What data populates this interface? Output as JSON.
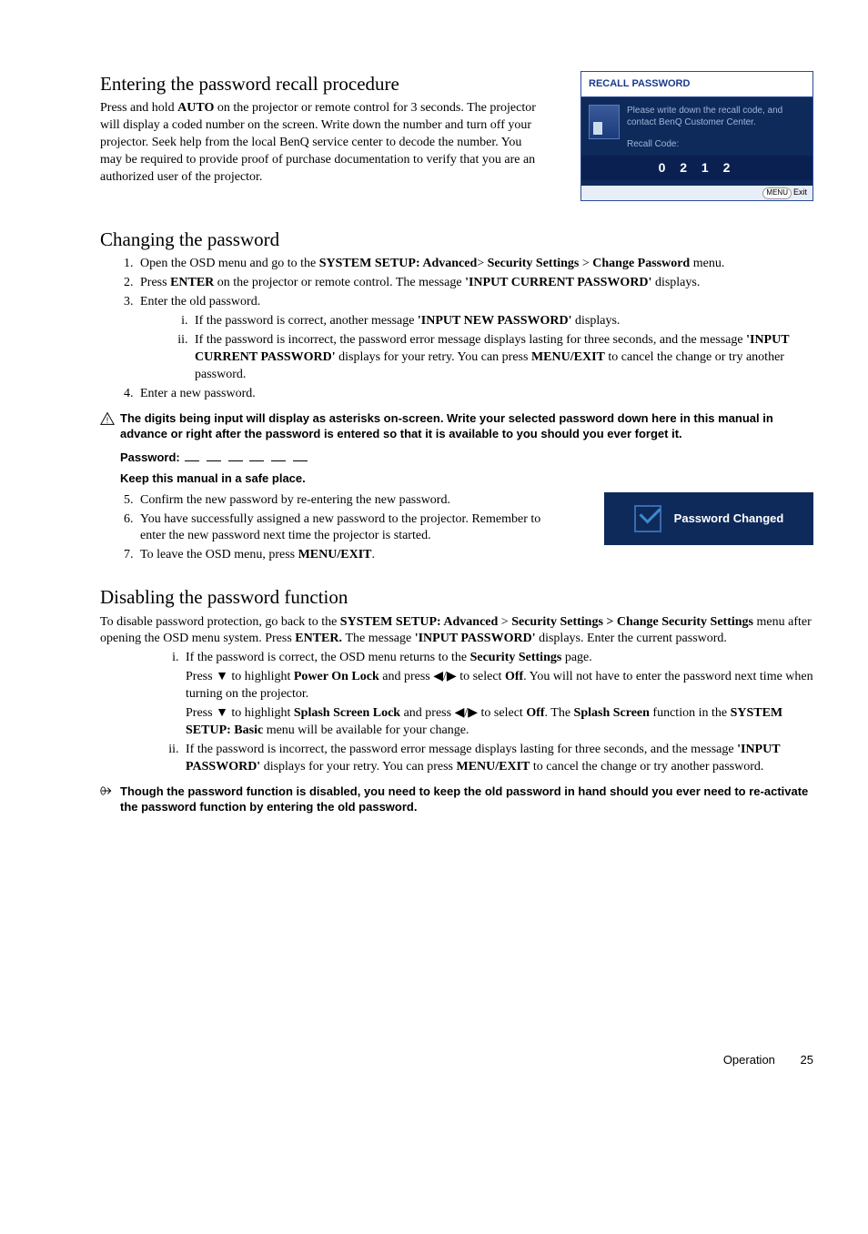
{
  "section1": {
    "heading": "Entering the password recall procedure",
    "para": "Press and hold AUTO on the projector or remote control for 3 seconds. The projector will display a coded number on the screen. Write down the number and turn off your projector. Seek help from the local BenQ service center to decode the number. You may be required to provide proof of purchase documentation to verify that you are an authorized user of the projector."
  },
  "recallBox": {
    "title": "RECALL PASSWORD",
    "msg": "Please write down the recall code, and contact BenQ Customer Center.",
    "codeLabel": "Recall Code:",
    "code": "0 2 1 2",
    "menuBtn": "MENU",
    "exit": "Exit"
  },
  "section2": {
    "heading": "Changing the password",
    "li1_a": "Open the OSD menu and go to the ",
    "li1_b": "SYSTEM SETUP: Advanced",
    "li1_c": "> ",
    "li1_d": "Security Settings",
    "li1_e": " > ",
    "li1_f": "Change Password",
    "li1_g": " menu.",
    "li2_a": "Press ",
    "li2_b": "ENTER",
    "li2_c": " on the projector or remote control. The message ",
    "li2_d": "'INPUT CURRENT PASSWORD'",
    "li2_e": " displays.",
    "li3": "Enter the old password.",
    "li3i_a": "If the password is correct, another message ",
    "li3i_b": "'INPUT NEW PASSWORD'",
    "li3i_c": " displays.",
    "li3ii_a": "If the password is incorrect, the password error message displays lasting for three seconds, and the message ",
    "li3ii_b": "'INPUT CURRENT PASSWORD'",
    "li3ii_c": " displays for your retry. You can press ",
    "li3ii_d": "MENU/EXIT",
    "li3ii_e": " to cancel the change or try another password.",
    "li4": "Enter a new password.",
    "warn": "The digits being input will display as asterisks on-screen. Write your selected password down here in this manual in advance or right after the password is entered so that it is available to you should you ever forget it.",
    "passwordLabel": "Password:",
    "keep": "Keep this manual in a safe place.",
    "li5": "Confirm the new password by re-entering the new password.",
    "li6": "You have successfully assigned a new password to the projector. Remember to enter the new password next time the projector is started.",
    "li7_a": "To leave the OSD menu, press ",
    "li7_b": "MENU/EXIT",
    "li7_c": "."
  },
  "changedBox": {
    "text": "Password Changed"
  },
  "section3": {
    "heading": "Disabling the password function",
    "p1_a": "To disable password protection, go back to the ",
    "p1_b": "SYSTEM SETUP: Advanced",
    "p1_c": " > ",
    "p1_d": "Security Settings > Change Security Settings",
    "p1_e": " menu after opening the OSD menu system. Press ",
    "p1_f": "ENTER. ",
    "p1_g": "The message ",
    "p1_h": "'INPUT PASSWORD'",
    "p1_i": " displays. Enter the current password.",
    "ri_a": "If the password is correct, the OSD menu returns to the ",
    "ri_b": "Security Settings",
    "ri_c": " page.",
    "rp1_a": "Press ",
    "rp1_b": " to highlight ",
    "rp1_c": "Power On Lock",
    "rp1_d": " and press ",
    "rp1_e": "  to select ",
    "rp1_f": "Off",
    "rp1_g": ". You will not have to enter the password next time when turning on the projector.",
    "rp2_a": "Press ",
    "rp2_b": " to highlight ",
    "rp2_c": "Splash Screen Lock",
    "rp2_d": " and press ",
    "rp2_e": "  to select ",
    "rp2_f": "Off",
    "rp2_g": ". The ",
    "rp2_h": "Splash Screen",
    "rp2_i": " function in the ",
    "rp2_j": "SYSTEM SETUP: Basic",
    "rp2_k": " menu will be available for your change.",
    "rii_a": "If the password is incorrect, the password error message displays lasting for three seconds, and the message ",
    "rii_b": "'INPUT PASSWORD'",
    "rii_c": " displays for your retry. You can press ",
    "rii_d": "MENU/EXIT",
    "rii_e": " to cancel the change or try another password.",
    "note": "Though the password function is disabled, you need to keep the old password in hand should you ever need to re-activate the password function by entering the old password."
  },
  "arrows": {
    "down": "▼",
    "left": "◀",
    "right": "▶"
  },
  "footer": {
    "section": "Operation",
    "page": "25"
  }
}
